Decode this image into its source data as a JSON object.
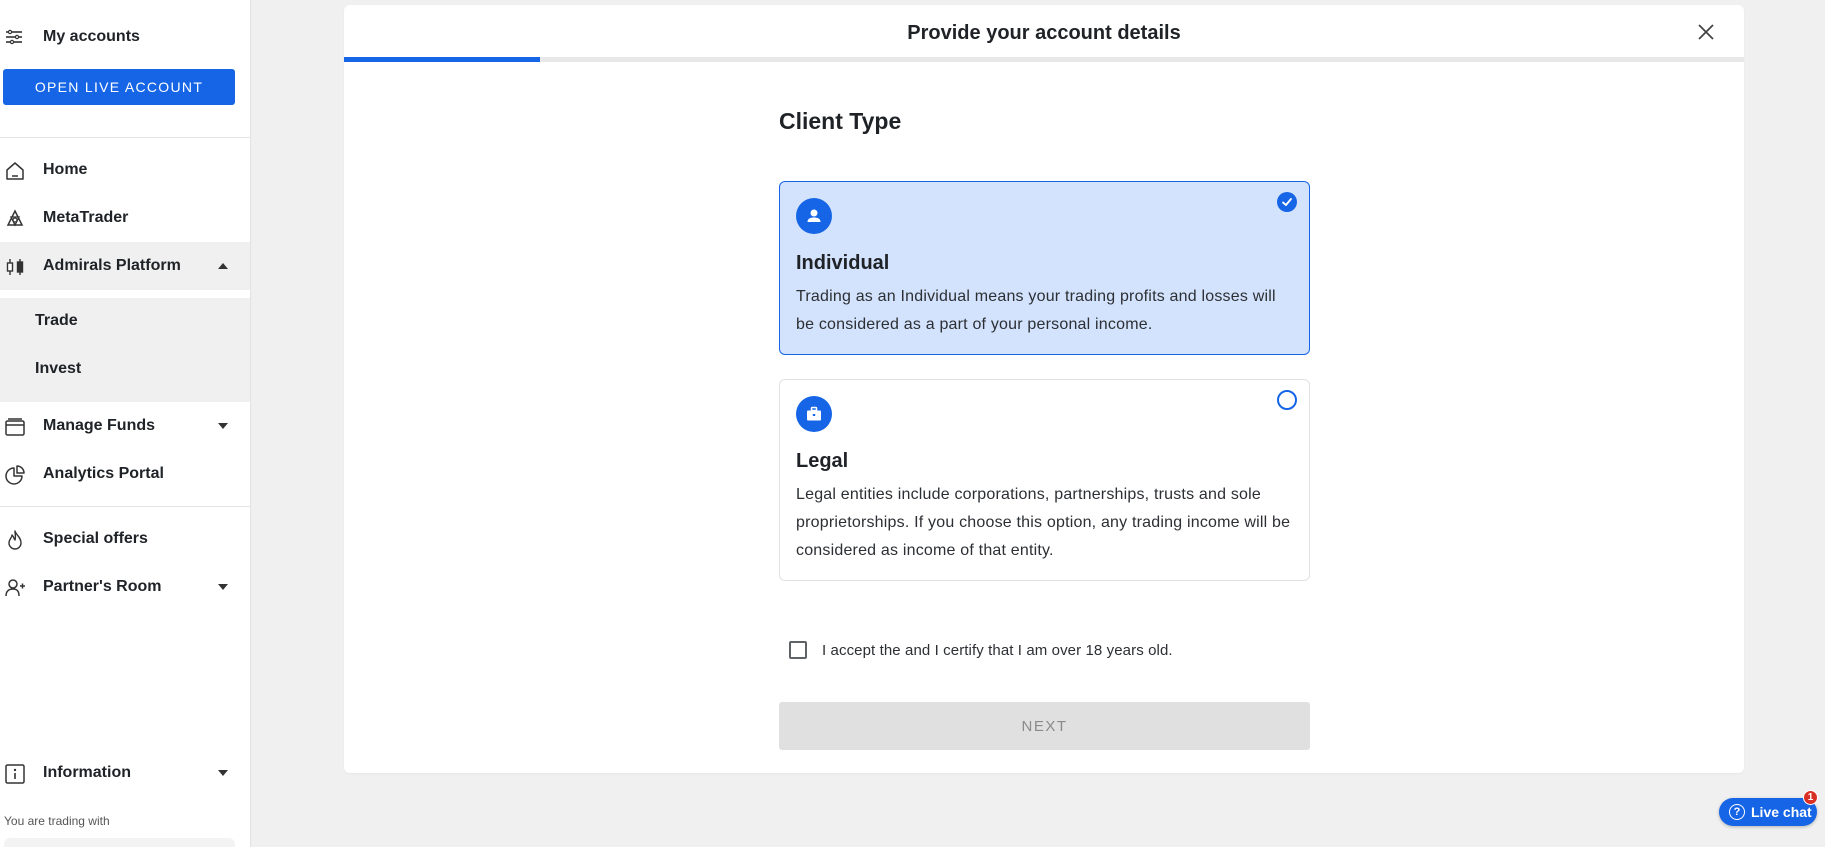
{
  "sidebar": {
    "title": "My accounts",
    "open_live_label": "OPEN LIVE ACCOUNT",
    "items": [
      {
        "label": "Home",
        "icon": "home-icon"
      },
      {
        "label": "MetaTrader",
        "icon": "metatrader-icon"
      },
      {
        "label": "Admirals Platform",
        "icon": "candlestick-icon",
        "expanded": true
      },
      {
        "label": "Manage Funds",
        "icon": "wallet-icon"
      },
      {
        "label": "Analytics Portal",
        "icon": "pie-chart-icon"
      },
      {
        "label": "Special offers",
        "icon": "flame-icon"
      },
      {
        "label": "Partner's Room",
        "icon": "person-add-icon"
      },
      {
        "label": "Information",
        "icon": "info-icon"
      }
    ],
    "sub_items": [
      "Trade",
      "Invest"
    ],
    "trading_with": "You are trading with"
  },
  "dialog": {
    "title": "Provide your account details",
    "progress_percent": 14,
    "section_title": "Client Type",
    "options": [
      {
        "title": "Individual",
        "description": "Trading as an Individual means your trading profits and losses will be considered as a part of your personal income.",
        "icon": "person-icon",
        "selected": true
      },
      {
        "title": "Legal",
        "description": "Legal entities include corporations, partnerships, trusts and sole proprietorships. If you choose this option, any trading income will be considered as income of that entity.",
        "icon": "briefcase-icon",
        "selected": false
      }
    ],
    "accept_text": "I accept the  and I certify that I am over 18 years old.",
    "accept_checked": false,
    "next_label": "NEXT"
  },
  "live_chat": {
    "label": "Live chat",
    "badge_count": "1"
  },
  "colors": {
    "accent": "#1565e6",
    "selected_bg": "#d3e3fd",
    "page_bg": "#f0f0f0",
    "disabled_btn": "#e0e0e0"
  }
}
